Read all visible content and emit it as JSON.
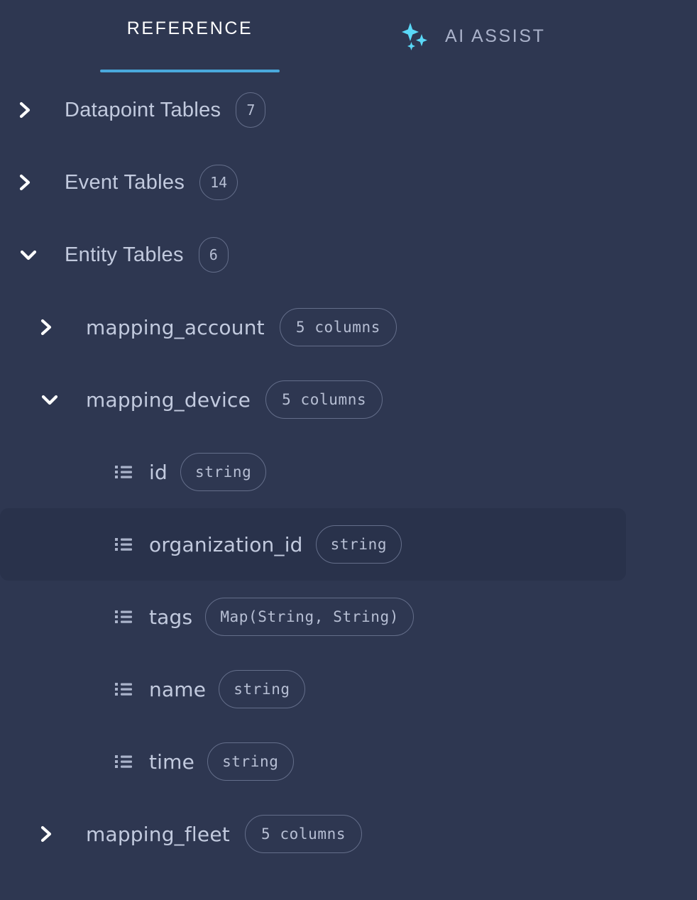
{
  "tabs": [
    {
      "id": "reference",
      "label": "REFERENCE",
      "active": true,
      "icon": null
    },
    {
      "id": "ai-assist",
      "label": "AI ASSIST",
      "active": false,
      "icon": "sparkles-icon"
    }
  ],
  "colors": {
    "background": "#2e3751",
    "selected_row": "#29324b",
    "active_tab_underline": "#4aa8dc",
    "active_tab_text": "#ffffff",
    "inactive_tab_text": "#aab2ca",
    "body_text": "#c2cade",
    "badge_border": "#646e8a",
    "badge_text": "#b7bfd4",
    "sparkle_icon": "#5ad8f7"
  },
  "tree": {
    "groups": [
      {
        "label": "Datapoint Tables",
        "count": "7",
        "expanded": false,
        "chevron": "chevron-right-icon",
        "tables": []
      },
      {
        "label": "Event Tables",
        "count": "14",
        "expanded": false,
        "chevron": "chevron-right-icon",
        "tables": []
      },
      {
        "label": "Entity Tables",
        "count": "6",
        "expanded": true,
        "chevron": "chevron-down-icon",
        "tables": [
          {
            "name": "mapping_account",
            "columns_label": "5 columns",
            "expanded": false,
            "chevron": "chevron-right-icon",
            "columns": []
          },
          {
            "name": "mapping_device",
            "columns_label": "5 columns",
            "expanded": true,
            "chevron": "chevron-down-icon",
            "columns": [
              {
                "name": "id",
                "type": "string",
                "selected": false,
                "icon": "list-icon"
              },
              {
                "name": "organization_id",
                "type": "string",
                "selected": true,
                "icon": "list-icon"
              },
              {
                "name": "tags",
                "type": "Map(String, String)",
                "selected": false,
                "icon": "list-icon"
              },
              {
                "name": "name",
                "type": "string",
                "selected": false,
                "icon": "list-icon"
              },
              {
                "name": "time",
                "type": "string",
                "selected": false,
                "icon": "list-icon"
              }
            ]
          },
          {
            "name": "mapping_fleet",
            "columns_label": "5 columns",
            "expanded": false,
            "chevron": "chevron-right-icon",
            "columns": []
          }
        ]
      }
    ]
  }
}
